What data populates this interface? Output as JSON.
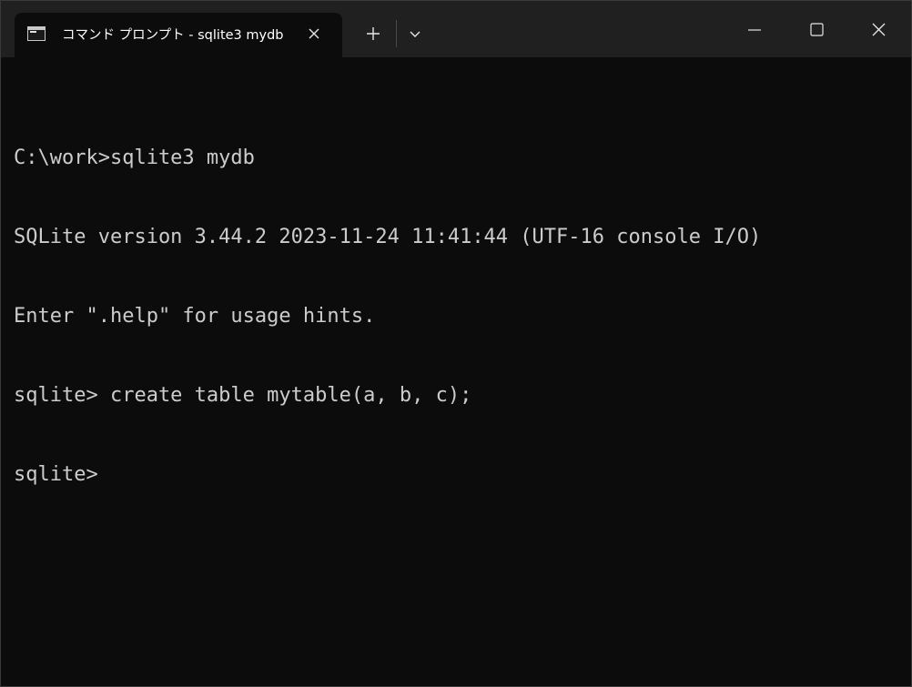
{
  "window": {
    "tab_title": "コマンド プロンプト - sqlite3  mydb",
    "close_tab_icon": "close-icon",
    "new_tab_icon": "plus-icon",
    "dropdown_icon": "chevron-down-icon",
    "controls": [
      "minimize-icon",
      "maximize-icon",
      "close-icon"
    ]
  },
  "terminal": {
    "lines": [
      "C:\\work>sqlite3 mydb",
      "SQLite version 3.44.2 2023-11-24 11:41:44 (UTF-16 console I/O)",
      "Enter \".help\" for usage hints.",
      "sqlite> create table mytable(a, b, c);",
      "sqlite>"
    ]
  },
  "colors": {
    "titlebar": "#202020",
    "terminal_bg": "#0c0c0c",
    "terminal_text": "#cccccc",
    "title_text": "#ffffff"
  }
}
